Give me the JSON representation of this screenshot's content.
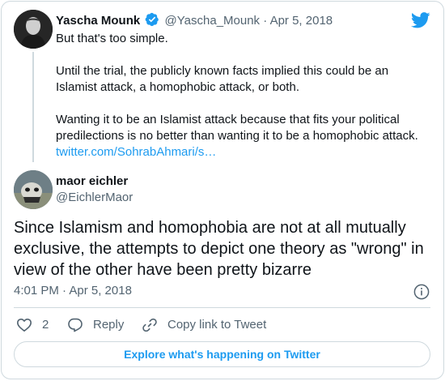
{
  "quoted_tweet": {
    "author_name": "Yascha Mounk",
    "author_handle": "@Yascha_Mounk",
    "separator": "·",
    "date": "Apr 5, 2018",
    "paragraph1": "But that's too simple.",
    "paragraph2": "Until the trial, the publicly known facts implied this could be an Islamist attack, a homophobic attack, or both.",
    "paragraph3": "Wanting it to be an Islamist attack because that fits your political predilections is no better than wanting it to be a homophobic attack.",
    "link": "twitter.com/SohrabAhmari/s…"
  },
  "main_tweet": {
    "author_name": "maor eichler",
    "author_handle": "@EichlerMaor",
    "text": "Since Islamism and homophobia are not at all mutually exclusive, the attempts to depict one theory as \"wrong\" in view of the other have been pretty bizarre",
    "timestamp": "4:01 PM · Apr 5, 2018"
  },
  "actions": {
    "like_count": "2",
    "reply_label": "Reply",
    "copy_label": "Copy link to Tweet"
  },
  "explore_label": "Explore what's happening on Twitter",
  "colors": {
    "accent": "#1d9bf0",
    "text": "#0f1419",
    "muted": "#536471",
    "border": "#cfd9de"
  },
  "icons": [
    "twitter-bird-icon",
    "verified-badge-icon",
    "info-icon",
    "heart-icon",
    "reply-bubble-icon",
    "link-icon"
  ]
}
